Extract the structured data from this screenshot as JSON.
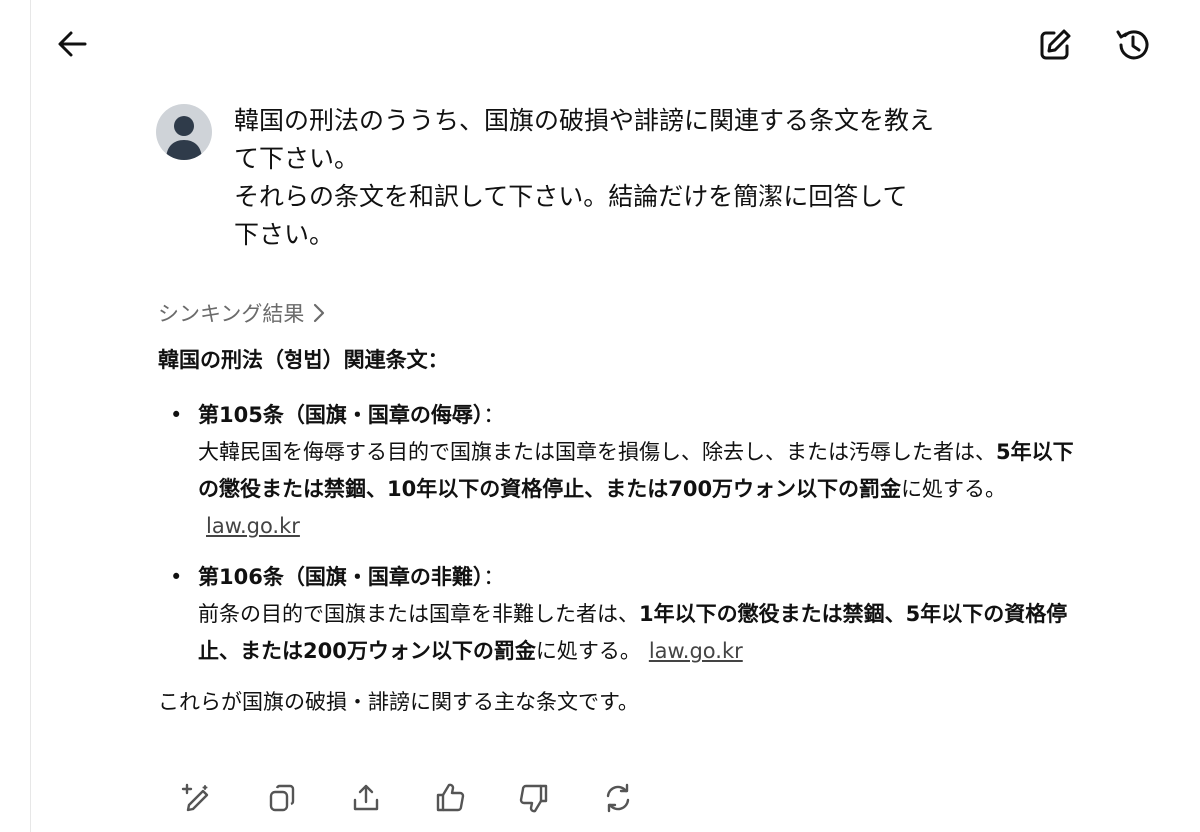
{
  "header": {
    "back_icon": "arrow-left-icon",
    "edit_icon": "edit-icon",
    "history_icon": "history-icon"
  },
  "user_message": {
    "lines": [
      "韓国の刑法のううち、国旗の破損や誹謗に関連する条文を教え",
      "て下さい。",
      "それらの条文を和訳して下さい。結論だけを簡潔に回答して",
      "下さい。"
    ]
  },
  "thinking": {
    "label": "シンキング結果"
  },
  "answer": {
    "heading": "韓国の刑法（형법）関連条文：",
    "items": [
      {
        "title": "第105条（国旗・国章の侮辱）",
        "sep": "：",
        "text_plain": "大韓民国を侮辱する目的で国旗または国章を損傷し、除去し、または汚辱した者は、",
        "text_bold": "5年以下の懲役または禁錮、10年以下の資格停止、または700万ウォン以下の罰金",
        "text_tail": "に処する。",
        "link": "law.go.kr"
      },
      {
        "title": "第106条（国旗・国章の非難）",
        "sep": "：",
        "text_plain": "前条の目的で国旗または国章を非難した者は、",
        "text_bold": "1年以下の懲役または禁錮、5年以下の資格停止、または200万ウォン以下の罰金",
        "text_tail": "に処する。",
        "link": "law.go.kr"
      }
    ],
    "closing": "これらが国旗の破損・誹謗に関する主な条文です。"
  },
  "actions": [
    "edit-spark-icon",
    "copy-icon",
    "share-icon",
    "thumbs-up-icon",
    "thumbs-down-icon",
    "regenerate-icon"
  ]
}
